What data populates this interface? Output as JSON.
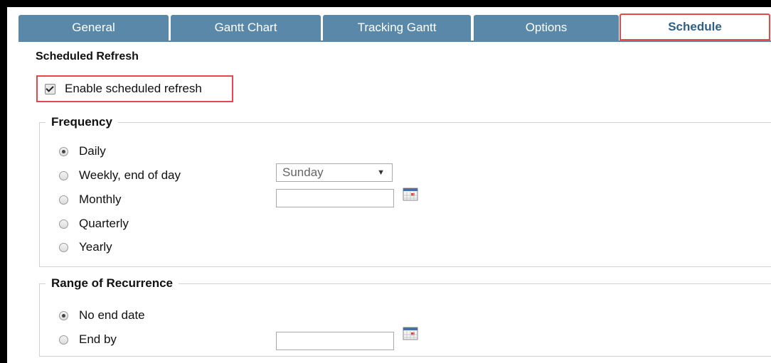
{
  "tabs": [
    {
      "label": "General",
      "active": false
    },
    {
      "label": "Gantt Chart",
      "active": false
    },
    {
      "label": "Tracking Gantt",
      "active": false
    },
    {
      "label": "Options",
      "active": false
    },
    {
      "label": "Schedule",
      "active": true
    }
  ],
  "section_title": "Scheduled Refresh",
  "enable": {
    "label": "Enable scheduled refresh",
    "checked": true
  },
  "frequency": {
    "legend": "Frequency",
    "options": [
      {
        "label": "Daily",
        "checked": true
      },
      {
        "label": "Weekly, end of day",
        "checked": false
      },
      {
        "label": "Monthly",
        "checked": false
      },
      {
        "label": "Quarterly",
        "checked": false
      },
      {
        "label": "Yearly",
        "checked": false
      }
    ],
    "weekday_select": {
      "value": "Sunday"
    },
    "monthly_date": {
      "value": ""
    }
  },
  "recurrence": {
    "legend": "Range of Recurrence",
    "options": [
      {
        "label": "No end date",
        "checked": true
      },
      {
        "label": "End by",
        "checked": false
      }
    ],
    "end_date": {
      "value": ""
    }
  },
  "icons": {
    "calendar": "calendar-icon",
    "dropdown": "chevron-down-icon"
  },
  "colors": {
    "tab_bg": "#5a88a8",
    "highlight": "#e8474a",
    "active_tab_text": "#2f5f85"
  }
}
